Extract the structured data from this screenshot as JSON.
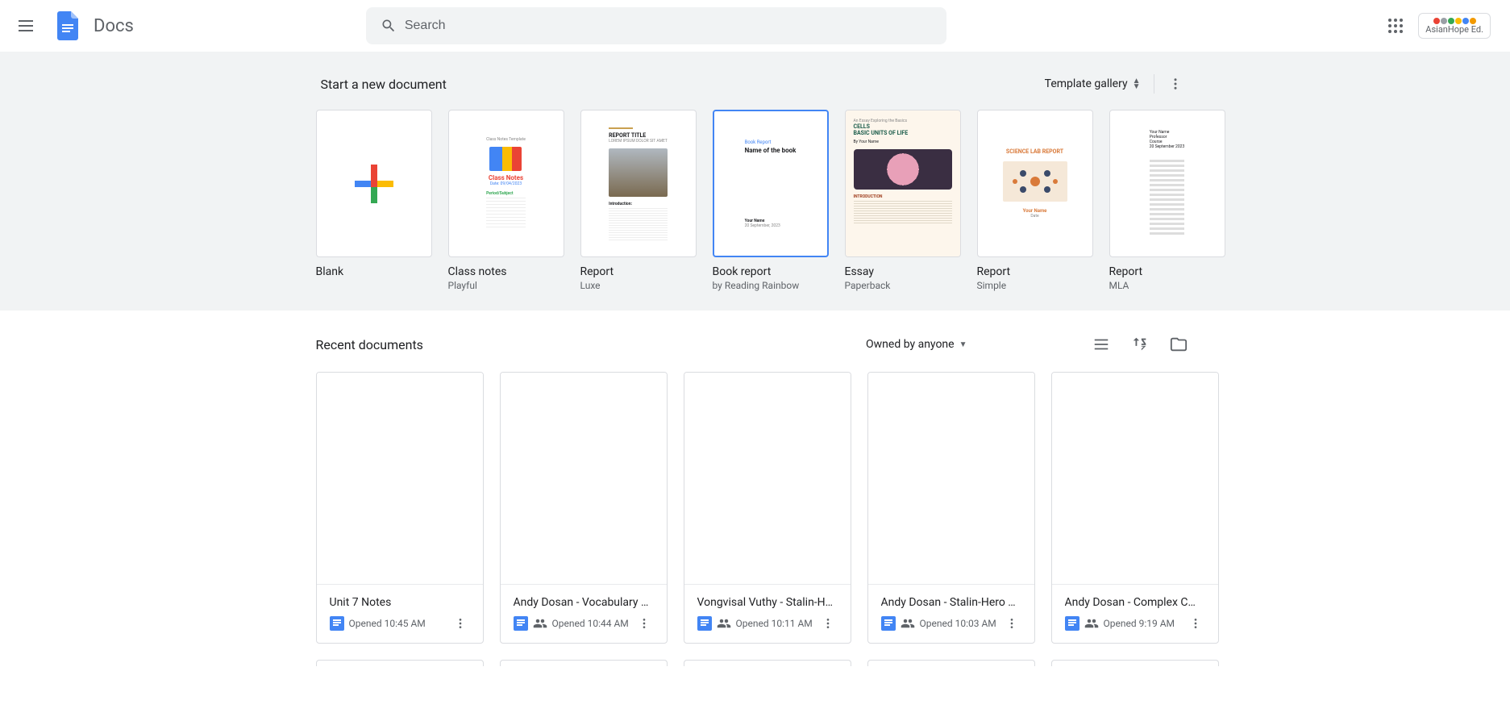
{
  "header": {
    "app_name": "Docs",
    "search_placeholder": "Search",
    "profile_label": "AsianHope Ed."
  },
  "templates": {
    "section_title": "Start a new document",
    "gallery_label": "Template gallery",
    "items": [
      {
        "name": "Blank",
        "sub": ""
      },
      {
        "name": "Class notes",
        "sub": "Playful"
      },
      {
        "name": "Report",
        "sub": "Luxe"
      },
      {
        "name": "Book report",
        "sub": "by Reading Rainbow"
      },
      {
        "name": "Essay",
        "sub": "Paperback"
      },
      {
        "name": "Report",
        "sub": "Simple"
      },
      {
        "name": "Report",
        "sub": "MLA"
      }
    ]
  },
  "recent": {
    "section_title": "Recent documents",
    "owned_label": "Owned by anyone",
    "docs": [
      {
        "title": "Unit 7 Notes",
        "time": "Opened 10:45 AM",
        "shared": false
      },
      {
        "title": "Andy Dosan - Vocabulary …",
        "time": "Opened 10:44 AM",
        "shared": true
      },
      {
        "title": "Vongvisal Vuthy - Stalin-H…",
        "time": "Opened 10:11 AM",
        "shared": true
      },
      {
        "title": "Andy Dosan - Stalin-Hero …",
        "time": "Opened 10:03 AM",
        "shared": true
      },
      {
        "title": "Andy Dosan - Complex C…",
        "time": "Opened 9:19 AM",
        "shared": true
      }
    ]
  }
}
